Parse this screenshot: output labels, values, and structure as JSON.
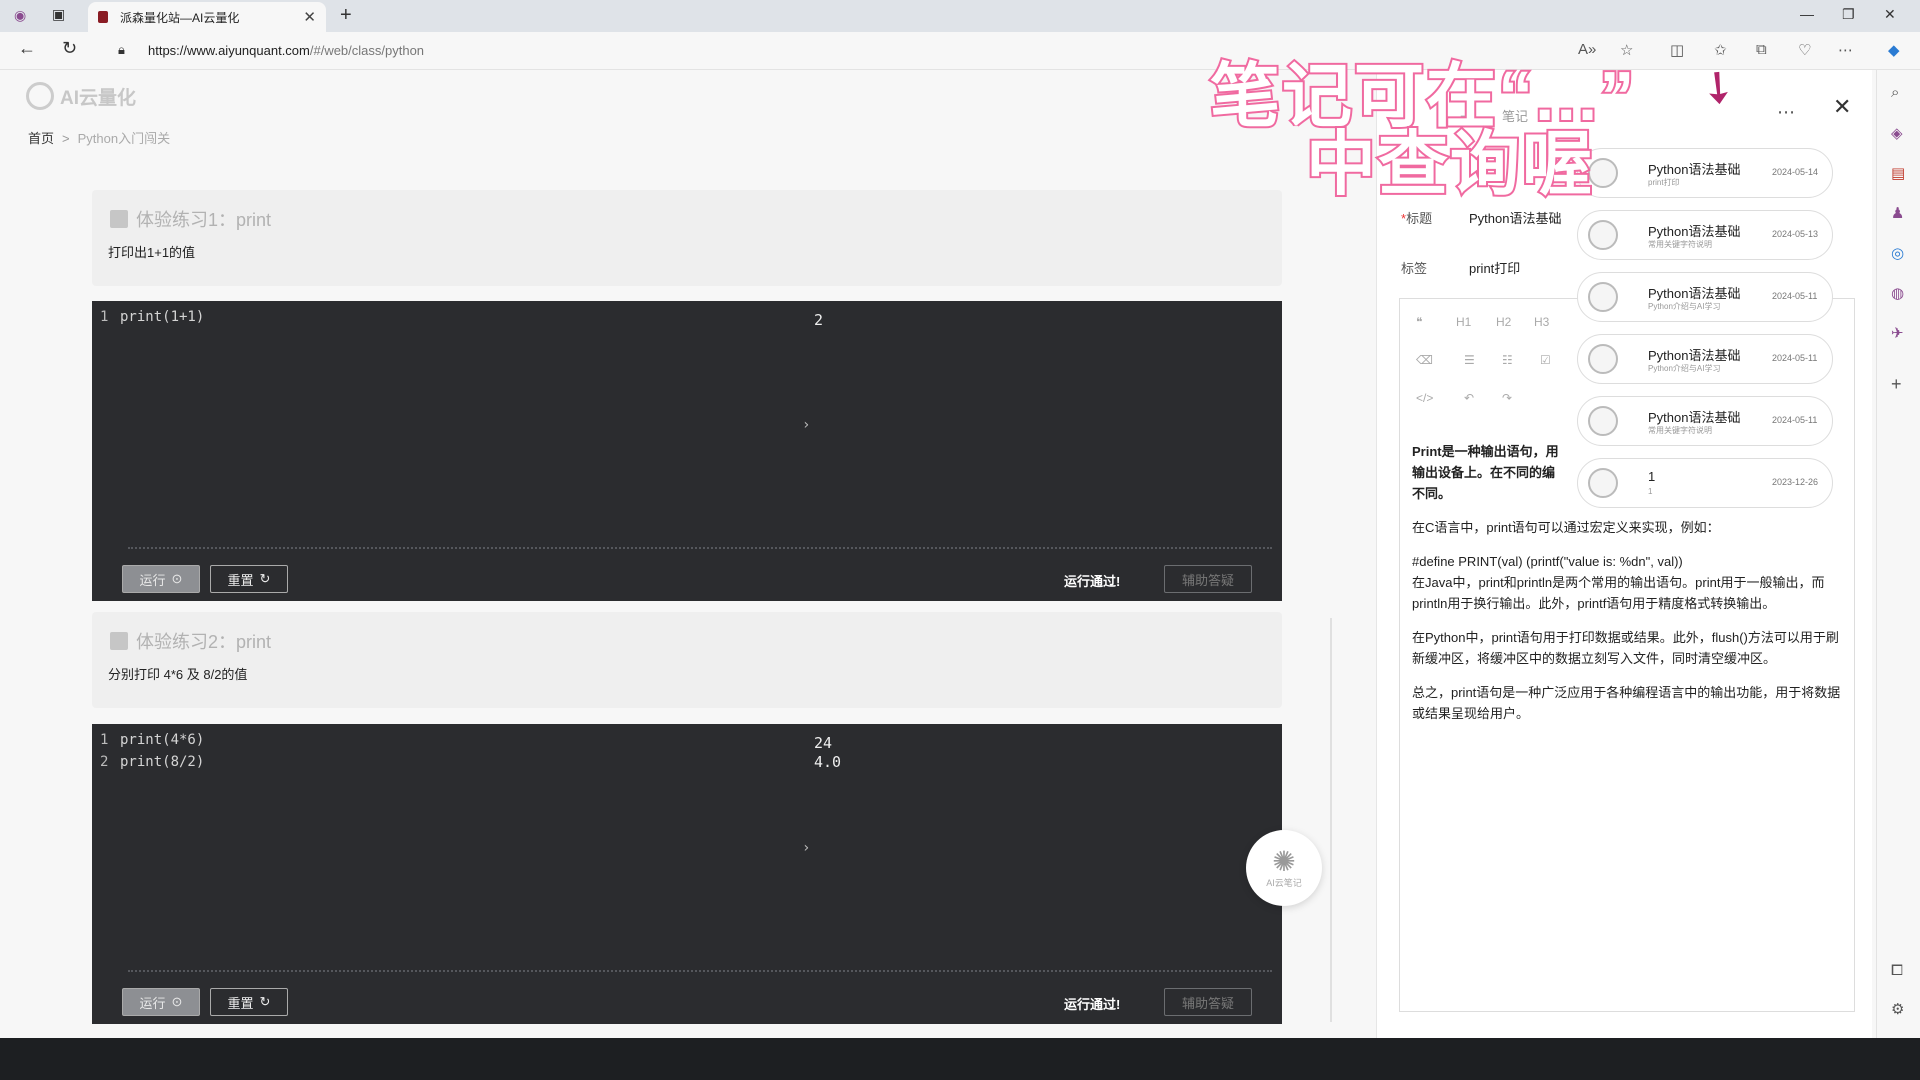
{
  "browser": {
    "tab_title": "派森量化站—AI云量化",
    "url_host": "https://www.aiyunquant.com",
    "url_path": "/#/web/class/python"
  },
  "site": {
    "logo_text": "AI云量化",
    "breadcrumb": {
      "home": "首页",
      "current": "Python入门闯关"
    }
  },
  "exercises": [
    {
      "title": "体验练习1：print",
      "desc": "打印出1+1的值",
      "code": [
        {
          "n": "1",
          "text": "print(1+1)"
        }
      ],
      "output": [
        "2"
      ],
      "run_label": "运行",
      "reset_label": "重置",
      "passed_label": "运行通过!",
      "ai_label": "辅助答疑"
    },
    {
      "title": "体验练习2：print",
      "desc": "分别打印 4*6 及 8/2的值",
      "code": [
        {
          "n": "1",
          "text": "print(4*6)"
        },
        {
          "n": "2",
          "text": "print(8/2)"
        }
      ],
      "output": [
        "24",
        "4.0"
      ],
      "run_label": "运行",
      "reset_label": "重置",
      "passed_label": "运行通过!",
      "ai_label": "辅助答疑"
    }
  ],
  "fab": {
    "label": "AI云笔记"
  },
  "notes_panel": {
    "tab_notes": "笔记",
    "title_label": "标题",
    "title_value": "Python语法基础",
    "tag_label": "标签",
    "tag_value": "print打印",
    "toolbar": [
      "H1",
      "H2",
      "H3"
    ],
    "content": {
      "p1": "Print是一种输出语句，用输出设备上。在不同的编不同。",
      "p2": "在C语言中，print语句可以通过宏定义来实现，例如：",
      "p3": "#define PRINT(val) (printf(\"value is: %dn\", val))",
      "p4": "在Java中，print和println是两个常用的输出语句。print用于一般输出，而println用于换行输出。此外，printf语句用于精度格式转换输出。",
      "p5": "在Python中，print语句用于打印数据或结果。此外，flush()方法可以用于刷新缓冲区，将缓冲区中的数据立刻写入文件，同时清空缓冲区。",
      "p6": "总之，print语句是一种广泛应用于各种编程语言中的输出功能，用于将数据或结果呈现给用户。"
    },
    "saved_notes": [
      {
        "title": "Python语法基础",
        "sub": "print打印",
        "date": "2024-05-14"
      },
      {
        "title": "Python语法基础",
        "sub": "常用关键字符说明",
        "date": "2024-05-13"
      },
      {
        "title": "Python语法基础",
        "sub": "Python介绍与AI学习",
        "date": "2024-05-11"
      },
      {
        "title": "Python语法基础",
        "sub": "Python介绍与AI学习",
        "date": "2024-05-11"
      },
      {
        "title": "Python语法基础",
        "sub": "常用关键字符说明",
        "date": "2024-05-11"
      },
      {
        "title": "1",
        "sub": "1",
        "date": "2023-12-26"
      }
    ]
  },
  "annotation": {
    "line1": "笔记可在“...”",
    "line2": "中查询喔",
    "color": "#f06aa0"
  }
}
